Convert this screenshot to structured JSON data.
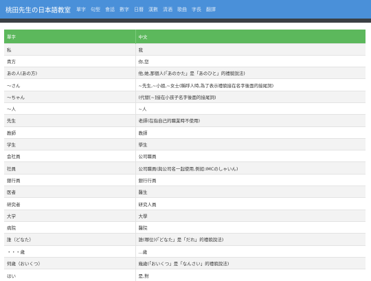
{
  "navbar": {
    "brand": "桃田先生の日本語教室",
    "items": [
      "單字",
      "句型",
      "會話",
      "數字",
      "日曆",
      "漢數",
      "清酒",
      "歌曲",
      "字長",
      "翻譯"
    ]
  },
  "table": {
    "headers": [
      "單字",
      "中文"
    ],
    "rows": [
      [
        "私",
        "我"
      ],
      [
        "貴方",
        "你,您"
      ],
      [
        "あの人(あの方)",
        "他,她,那個人(「あのかた」是「あのひと」的禮貌說法)"
      ],
      [
        "～さん",
        "~先生,~小姐,~女士(稱呼人時,為了表示禮貌接在名字後面的接尾詞)"
      ],
      [
        "～ちゃん",
        "(代替[~]接在小孩子名字後面的接尾詞)"
      ],
      [
        "～人",
        "~人"
      ],
      [
        "先生",
        "老師(在指自己的職業時不使用)"
      ],
      [
        "教師",
        "教師"
      ],
      [
        "学生",
        "學生"
      ],
      [
        "会社員",
        "公司職員"
      ],
      [
        "社員",
        "公司職員(與公司名一起使用,例如:IMCのしゃいん)"
      ],
      [
        "銀行員",
        "銀行行員"
      ],
      [
        "医者",
        "醫生"
      ],
      [
        "研究者",
        "研究人員"
      ],
      [
        "大学",
        "大學"
      ],
      [
        "病院",
        "醫院"
      ],
      [
        "誰（どなた）",
        "誰(哪位)(「どなた」是「だれ」的禮貌說法)"
      ],
      [
        "・・・歳",
        "...歲"
      ],
      [
        "何歳（おいくつ）",
        "幾歲(「おいくつ」是「なんさい」的禮貌說法)"
      ],
      [
        "はい",
        "是,對"
      ]
    ]
  }
}
